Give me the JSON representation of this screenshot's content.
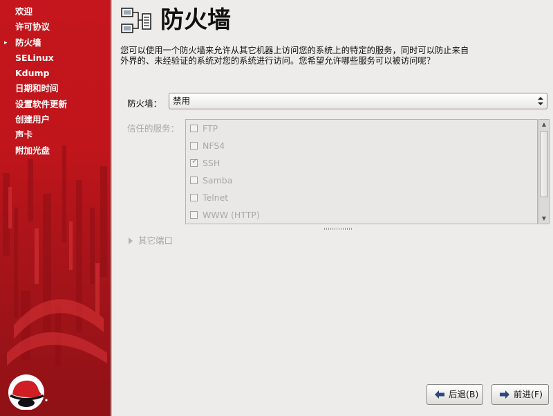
{
  "sidebar": {
    "current_marker": "▸",
    "items": [
      {
        "label": "欢迎"
      },
      {
        "label": "许可协议"
      },
      {
        "label": "防火墙",
        "current": true
      },
      {
        "label": "SELinux"
      },
      {
        "label": "Kdump"
      },
      {
        "label": "日期和时间"
      },
      {
        "label": "设置软件更新"
      },
      {
        "label": "创建用户"
      },
      {
        "label": "声卡"
      },
      {
        "label": "附加光盘"
      }
    ]
  },
  "page": {
    "title": "防火墙",
    "title_icon": "network-firewall-icon",
    "description": "您可以使用一个防火墙来允许从其它机器上访问您的系统上的特定的服务，同时可以防止来自外界的、未经验证的系统对您的系统进行访问。您希望允许哪些服务可以被访问呢？"
  },
  "firewall": {
    "label": "防火墙：",
    "selected": "禁用"
  },
  "trusted_services": {
    "label": "信任的服务：",
    "items": [
      {
        "name": "FTP",
        "checked": false
      },
      {
        "name": "NFS4",
        "checked": false
      },
      {
        "name": "SSH",
        "checked": true
      },
      {
        "name": "Samba",
        "checked": false
      },
      {
        "name": "Telnet",
        "checked": false
      },
      {
        "name": "WWW (HTTP)",
        "checked": false
      }
    ],
    "check_mark": "✓"
  },
  "other_ports": {
    "label": "其它端口"
  },
  "buttons": {
    "back": "后退(B)",
    "next": "前进(F)"
  },
  "colors": {
    "sidebar_red": "#c4161c",
    "background": "#edeceb",
    "disabled_text": "#a9a8a6",
    "button_arrow": "#2e4a7a"
  }
}
